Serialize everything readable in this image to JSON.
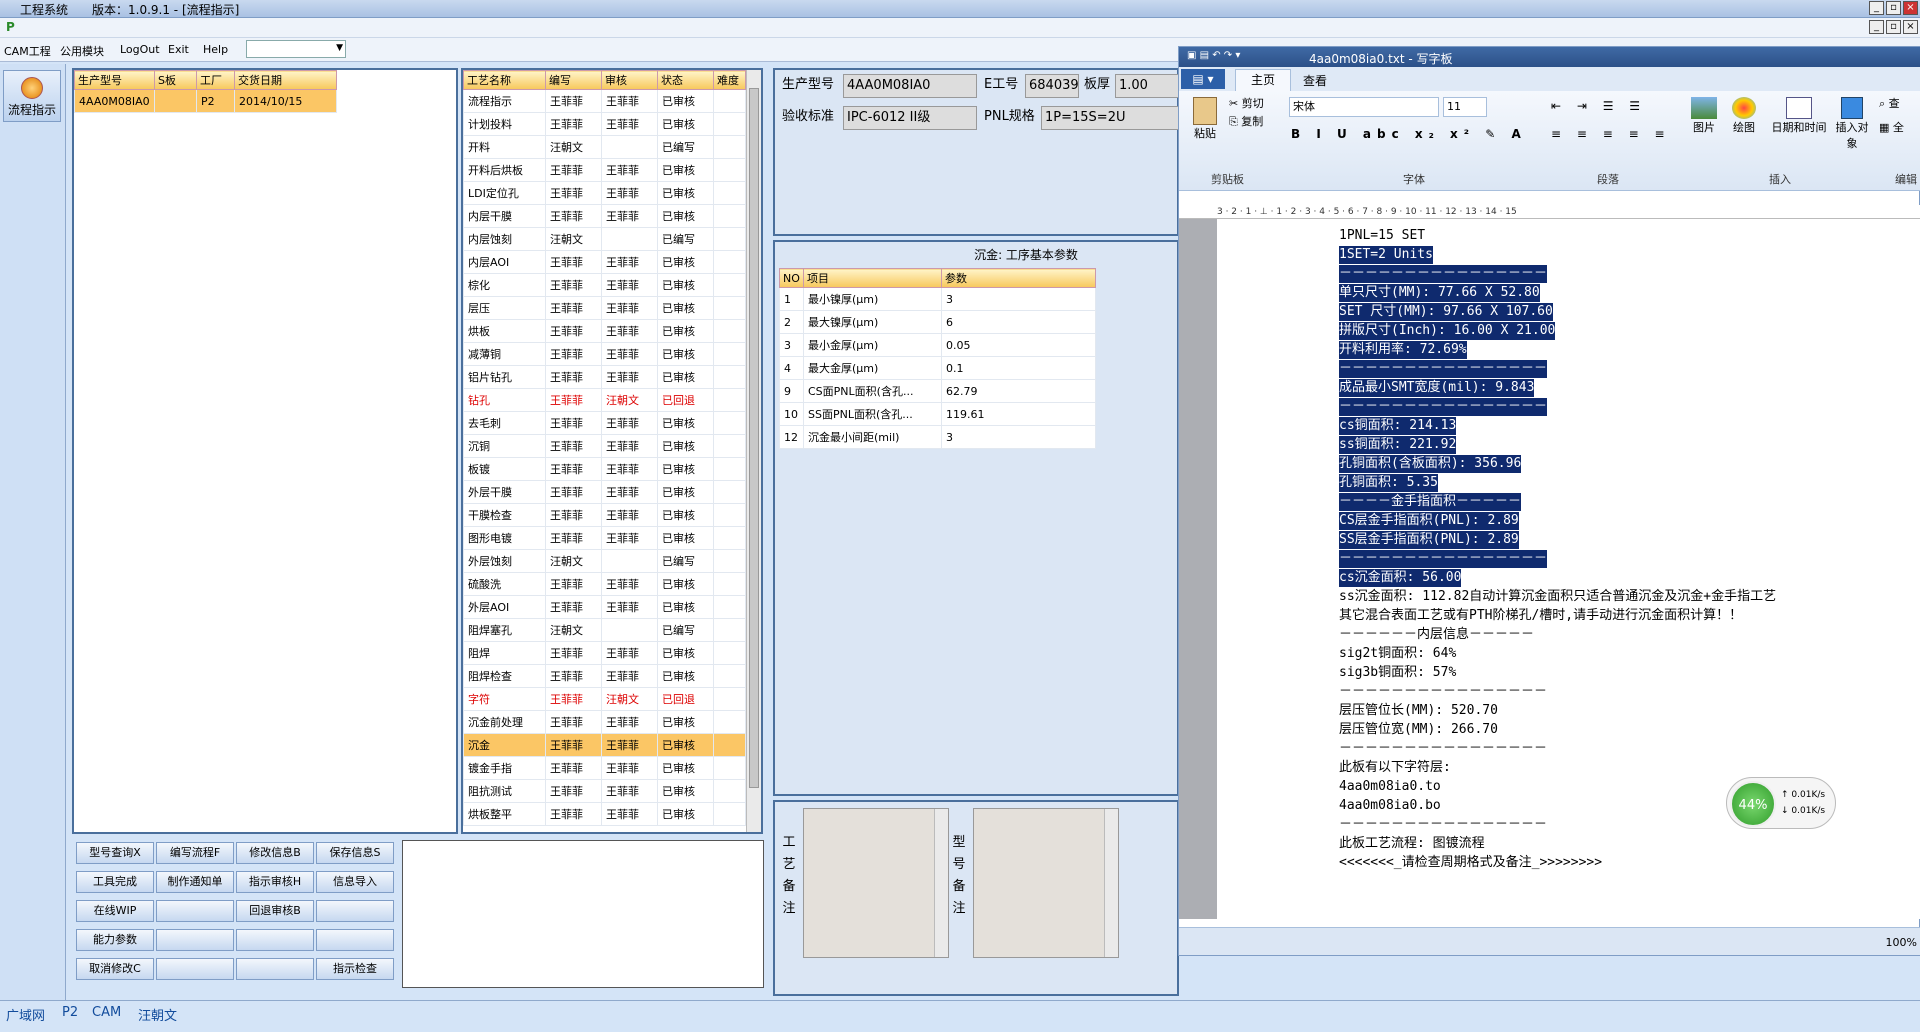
{
  "window": {
    "title": "工程系统",
    "version": "版本：1.0.9.1 - [流程指示]"
  },
  "menu": {
    "items": [
      "CAM工程",
      "公用模块",
      "LogOut",
      "Exit",
      "Help"
    ]
  },
  "leftbar": {
    "button": "流程指示"
  },
  "order_table": {
    "headers": [
      "生产型号",
      "S板",
      "工厂",
      "交货日期"
    ],
    "rows": [
      [
        "4AA0M08IA0",
        "",
        "P2",
        "2014/10/15"
      ]
    ]
  },
  "process_table": {
    "headers": [
      "工艺名称",
      "编写",
      "审核",
      "状态",
      "难度"
    ],
    "rows": [
      [
        "流程指示",
        "王菲菲",
        "王菲菲",
        "已审核",
        ""
      ],
      [
        "计划投料",
        "王菲菲",
        "王菲菲",
        "已审核",
        ""
      ],
      [
        "开料",
        "汪朝文",
        "",
        "已编写",
        ""
      ],
      [
        "开料后烘板",
        "王菲菲",
        "王菲菲",
        "已审核",
        ""
      ],
      [
        "LDI定位孔",
        "王菲菲",
        "王菲菲",
        "已审核",
        ""
      ],
      [
        "内层干膜",
        "王菲菲",
        "王菲菲",
        "已审核",
        ""
      ],
      [
        "内层蚀刻",
        "汪朝文",
        "",
        "已编写",
        ""
      ],
      [
        "内层AOI",
        "王菲菲",
        "王菲菲",
        "已审核",
        ""
      ],
      [
        "棕化",
        "王菲菲",
        "王菲菲",
        "已审核",
        ""
      ],
      [
        "层压",
        "王菲菲",
        "王菲菲",
        "已审核",
        ""
      ],
      [
        "烘板",
        "王菲菲",
        "王菲菲",
        "已审核",
        ""
      ],
      [
        "减薄铜",
        "王菲菲",
        "王菲菲",
        "已审核",
        ""
      ],
      [
        "铝片钻孔",
        "王菲菲",
        "王菲菲",
        "已审核",
        ""
      ],
      [
        "钻孔",
        "王菲菲",
        "汪朝文",
        "已回退",
        ""
      ],
      [
        "去毛刺",
        "王菲菲",
        "王菲菲",
        "已审核",
        ""
      ],
      [
        "沉铜",
        "王菲菲",
        "王菲菲",
        "已审核",
        ""
      ],
      [
        "板镀",
        "王菲菲",
        "王菲菲",
        "已审核",
        ""
      ],
      [
        "外层干膜",
        "王菲菲",
        "王菲菲",
        "已审核",
        ""
      ],
      [
        "干膜检查",
        "王菲菲",
        "王菲菲",
        "已审核",
        ""
      ],
      [
        "图形电镀",
        "王菲菲",
        "王菲菲",
        "已审核",
        ""
      ],
      [
        "外层蚀刻",
        "汪朝文",
        "",
        "已编写",
        ""
      ],
      [
        "硫酸洗",
        "王菲菲",
        "王菲菲",
        "已审核",
        ""
      ],
      [
        "外层AOI",
        "王菲菲",
        "王菲菲",
        "已审核",
        ""
      ],
      [
        "阻焊塞孔",
        "汪朝文",
        "",
        "已编写",
        ""
      ],
      [
        "阻焊",
        "王菲菲",
        "王菲菲",
        "已审核",
        ""
      ],
      [
        "阻焊检查",
        "王菲菲",
        "王菲菲",
        "已审核",
        ""
      ],
      [
        "字符",
        "王菲菲",
        "汪朝文",
        "已回退",
        ""
      ],
      [
        "沉金前处理",
        "王菲菲",
        "王菲菲",
        "已审核",
        ""
      ],
      [
        "沉金",
        "王菲菲",
        "王菲菲",
        "已审核",
        ""
      ],
      [
        "镀金手指",
        "王菲菲",
        "王菲菲",
        "已审核",
        ""
      ],
      [
        "阻抗测试",
        "王菲菲",
        "王菲菲",
        "已审核",
        ""
      ],
      [
        "烘板整平",
        "王菲菲",
        "王菲菲",
        "已审核",
        ""
      ]
    ],
    "red_rows": [
      13,
      26
    ],
    "selected_row": 28
  },
  "buttons": [
    [
      "型号查询X",
      "编写流程F",
      "修改信息B",
      "保存信息S"
    ],
    [
      "工具完成",
      "制作通知单",
      "指示审核H",
      "信息导入"
    ],
    [
      "在线WIP",
      "",
      "回退审核B",
      ""
    ],
    [
      "能力参数",
      "",
      "",
      ""
    ],
    [
      "取消修改C",
      "",
      "",
      "指示检查"
    ]
  ],
  "info": {
    "model_label": "生产型号",
    "model_value": "4AA0M08IA0",
    "e_label": "E工号",
    "e_value": "684039",
    "thick_label": "板厚",
    "thick_value": "1.00",
    "std_label": "验收标准",
    "std_value": "IPC-6012 II级",
    "pnl_label": "PNL规格",
    "pnl_value": "1P=15S=2U"
  },
  "params": {
    "title": "沉金: 工序基本参数",
    "headers": [
      "NO",
      "项目",
      "参数"
    ],
    "rows": [
      [
        "1",
        "最小镍厚(μm)",
        "3"
      ],
      [
        "2",
        "最大镍厚(μm)",
        "6"
      ],
      [
        "3",
        "最小金厚(μm)",
        "0.05"
      ],
      [
        "4",
        "最大金厚(μm)",
        "0.1"
      ],
      [
        "9",
        "CS面PNL面积(含孔...",
        "62.79"
      ],
      [
        "10",
        "SS面PNL面积(含孔...",
        "119.61"
      ],
      [
        "12",
        "沉金最小间距(mil)",
        "3"
      ]
    ]
  },
  "remarks": {
    "process": "工艺备注",
    "model": "型号备注"
  },
  "status": {
    "items": [
      "广域网",
      "P2",
      "CAM",
      "汪朝文"
    ]
  },
  "wordpad": {
    "title": "4aa0m08ia0.txt - 写字板",
    "tabs": [
      "主页",
      "查看"
    ],
    "ribbon": {
      "paste": "粘贴",
      "cut": "剪切",
      "copy": "复制",
      "clipboard": "剪贴板",
      "font_name": "宋体",
      "font_size": "11",
      "font": "字体",
      "paragraph": "段落",
      "picture": "图片",
      "paint": "绘图",
      "datetime": "日期和时间",
      "insert_obj": "插入对象",
      "insert": "插入",
      "find": "查",
      "all": "全",
      "edit": "编辑"
    },
    "ruler": "3 · 2 · 1 · ⊥ · 1 · 2 · 3 · 4 · 5 · 6 · 7 · 8 · 9 · 10 · 11 · 12 · 13 · 14 · 15",
    "lines": [
      {
        "t": "1PNL=15 SET",
        "h": false
      },
      {
        "t": "1SET=2 Units",
        "h": true
      },
      {
        "t": "－－－－－－－－－－－－－－－－",
        "h": true
      },
      {
        "t": "单只尺寸(MM): 77.66 X 52.80",
        "h": true
      },
      {
        "t": "SET 尺寸(MM): 97.66 X 107.60",
        "h": true
      },
      {
        "t": "拼版尺寸(Inch): 16.00 X 21.00",
        "h": true
      },
      {
        "t": "开料利用率: 72.69%",
        "h": true
      },
      {
        "t": "－－－－－－－－－－－－－－－－",
        "h": true
      },
      {
        "t": "成品最小SMT宽度(mil): 9.843",
        "h": true
      },
      {
        "t": "－－－－－－－－－－－－－－－－",
        "h": true
      },
      {
        "t": "cs铜面积: 214.13",
        "h": true
      },
      {
        "t": "ss铜面积: 221.92",
        "h": true
      },
      {
        "t": "孔铜面积(含板面积): 356.96",
        "h": true
      },
      {
        "t": "孔铜面积: 5.35",
        "h": true
      },
      {
        "t": "－－－－金手指面积－－－－－",
        "h": true
      },
      {
        "t": "CS层金手指面积(PNL): 2.89",
        "h": true
      },
      {
        "t": "SS层金手指面积(PNL): 2.89",
        "h": true
      },
      {
        "t": "－－－－－－－－－－－－－－－－",
        "h": true
      },
      {
        "t": "cs沉金面积: 56.00",
        "h": true
      },
      {
        "t": "ss沉金面积: 112.82自动计算沉金面积只适合普通沉金及沉金+金手指工艺",
        "h": false
      },
      {
        "t": "其它混合表面工艺或有PTH阶梯孔/槽时,请手动进行沉金面积计算！！",
        "h": false
      },
      {
        "t": "－－－－－－内层信息－－－－－",
        "h": false
      },
      {
        "t": "sig2t铜面积: 64%",
        "h": false
      },
      {
        "t": "sig3b铜面积: 57%",
        "h": false
      },
      {
        "t": "－－－－－－－－－－－－－－－－",
        "h": false
      },
      {
        "t": "层压管位长(MM): 520.70",
        "h": false
      },
      {
        "t": "层压管位宽(MM): 266.70",
        "h": false
      },
      {
        "t": "－－－－－－－－－－－－－－－－",
        "h": false
      },
      {
        "t": "此板有以下字符层:",
        "h": false
      },
      {
        "t": "4aa0m08ia0.to",
        "h": false
      },
      {
        "t": "4aa0m08ia0.bo",
        "h": false
      },
      {
        "t": "－－－－－－－－－－－－－－－－",
        "h": false
      },
      {
        "t": "此板工艺流程: 图镀流程",
        "h": false
      },
      {
        "t": "<<<<<<<_请检查周期格式及备注_>>>>>>>>",
        "h": false
      }
    ],
    "zoom": "100%"
  },
  "net": {
    "percent": "44%",
    "up": "0.01K/s",
    "down": "0.01K/s"
  }
}
